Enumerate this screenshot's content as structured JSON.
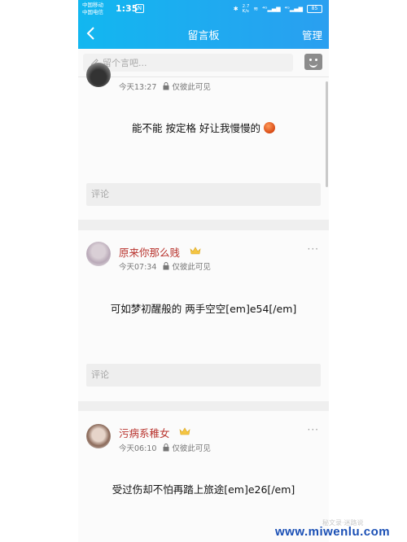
{
  "status": {
    "carrier1": "中国移动",
    "carrier2": "中国电信",
    "time": "1:35",
    "n_badge": "N",
    "speed": "2.7\nK/s",
    "net1": "⁴ᴳ",
    "net2": "⁴ᴳ",
    "battery": "85"
  },
  "nav": {
    "back_icon": "chevron-left-icon",
    "title": "留言板",
    "manage_label": "管理"
  },
  "input": {
    "placeholder": "留个言吧..."
  },
  "posts": [
    {
      "time": "今天13:27",
      "visibility": "仅彼此可见",
      "content": "能不能 按定格 好让我慢慢的",
      "comment_placeholder": "评论"
    },
    {
      "username": "原来你那么贱",
      "time": "今天07:34",
      "visibility": "仅彼此可见",
      "content": "可如梦初醒般的 两手空空[em]e54[/em]",
      "comment_placeholder": "评论",
      "more": "···"
    },
    {
      "username": "污病系稚女",
      "time": "今天06:10",
      "visibility": "仅彼此可见",
      "content": "受过伤却不怕再踏上旅途[em]e26[/em]",
      "more": "···"
    }
  ],
  "colors": {
    "header": "#1bb0f0",
    "username": "#b8332d",
    "watermark": "#1a4fb5"
  },
  "watermark": {
    "text": "www.miwenlu.com",
    "small": "秘文录·迷路说"
  }
}
